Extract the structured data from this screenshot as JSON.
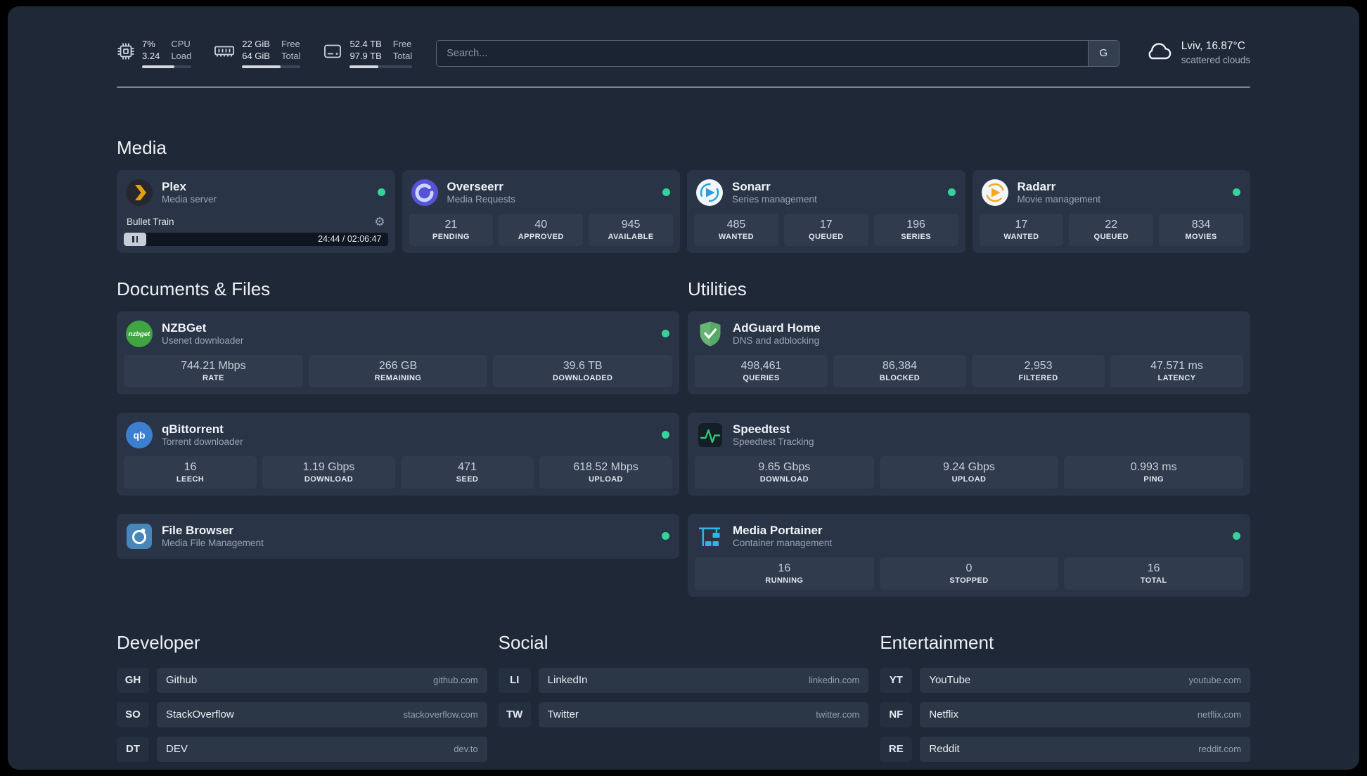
{
  "topbar": {
    "cpu": {
      "value_top": "7%",
      "value_bottom": "3.24",
      "label_top": "CPU",
      "label_bottom": "Load",
      "bar_percent": 65
    },
    "memory": {
      "value_top": "22 GiB",
      "value_bottom": "64 GiB",
      "label_top": "Free",
      "label_bottom": "Total",
      "bar_percent": 66
    },
    "disk": {
      "value_top": "52.4 TB",
      "value_bottom": "97.9 TB",
      "label_top": "Free",
      "label_bottom": "Total",
      "bar_percent": 46
    },
    "search": {
      "placeholder": "Search...",
      "button_label": "G"
    },
    "weather": {
      "location": "Lviv, 16.87°C",
      "condition": "scattered clouds"
    }
  },
  "colors": {
    "status_online": "#34d399",
    "background": "#1e2836",
    "card": "#293447"
  },
  "media": {
    "title": "Media",
    "plex": {
      "name": "Plex",
      "subtitle": "Media server",
      "player": {
        "track": "Bullet Train",
        "time": "24:44 / 02:06:47"
      }
    },
    "overseerr": {
      "name": "Overseerr",
      "subtitle": "Media Requests",
      "stats": [
        {
          "value": "21",
          "label": "PENDING"
        },
        {
          "value": "40",
          "label": "APPROVED"
        },
        {
          "value": "945",
          "label": "AVAILABLE"
        }
      ]
    },
    "sonarr": {
      "name": "Sonarr",
      "subtitle": "Series management",
      "stats": [
        {
          "value": "485",
          "label": "WANTED"
        },
        {
          "value": "17",
          "label": "QUEUED"
        },
        {
          "value": "196",
          "label": "SERIES"
        }
      ]
    },
    "radarr": {
      "name": "Radarr",
      "subtitle": "Movie management",
      "stats": [
        {
          "value": "17",
          "label": "WANTED"
        },
        {
          "value": "22",
          "label": "QUEUED"
        },
        {
          "value": "834",
          "label": "MOVIES"
        }
      ]
    }
  },
  "documents": {
    "title": "Documents & Files",
    "nzbget": {
      "name": "NZBGet",
      "subtitle": "Usenet downloader",
      "stats": [
        {
          "value": "744.21 Mbps",
          "label": "RATE"
        },
        {
          "value": "266 GB",
          "label": "REMAINING"
        },
        {
          "value": "39.6 TB",
          "label": "DOWNLOADED"
        }
      ]
    },
    "qbittorrent": {
      "name": "qBittorrent",
      "subtitle": "Torrent downloader",
      "stats": [
        {
          "value": "16",
          "label": "LEECH"
        },
        {
          "value": "1.19 Gbps",
          "label": "DOWNLOAD"
        },
        {
          "value": "471",
          "label": "SEED"
        },
        {
          "value": "618.52 Mbps",
          "label": "UPLOAD"
        }
      ]
    },
    "filebrowser": {
      "name": "File Browser",
      "subtitle": "Media File Management"
    }
  },
  "utilities": {
    "title": "Utilities",
    "adguard": {
      "name": "AdGuard Home",
      "subtitle": "DNS and adblocking",
      "stats": [
        {
          "value": "498,461",
          "label": "QUERIES"
        },
        {
          "value": "86,384",
          "label": "BLOCKED"
        },
        {
          "value": "2,953",
          "label": "FILTERED"
        },
        {
          "value": "47.571 ms",
          "label": "LATENCY"
        }
      ]
    },
    "speedtest": {
      "name": "Speedtest",
      "subtitle": "Speedtest Tracking",
      "stats": [
        {
          "value": "9.65 Gbps",
          "label": "DOWNLOAD"
        },
        {
          "value": "9.24 Gbps",
          "label": "UPLOAD"
        },
        {
          "value": "0.993 ms",
          "label": "PING"
        }
      ]
    },
    "portainer": {
      "name": "Media Portainer",
      "subtitle": "Container management",
      "stats": [
        {
          "value": "16",
          "label": "RUNNING"
        },
        {
          "value": "0",
          "label": "STOPPED"
        },
        {
          "value": "16",
          "label": "TOTAL"
        }
      ]
    }
  },
  "bookmarks": {
    "developer": {
      "title": "Developer",
      "items": [
        {
          "abbr": "GH",
          "name": "Github",
          "domain": "github.com"
        },
        {
          "abbr": "SO",
          "name": "StackOverflow",
          "domain": "stackoverflow.com"
        },
        {
          "abbr": "DT",
          "name": "DEV",
          "domain": "dev.to"
        }
      ]
    },
    "social": {
      "title": "Social",
      "items": [
        {
          "abbr": "LI",
          "name": "LinkedIn",
          "domain": "linkedin.com"
        },
        {
          "abbr": "TW",
          "name": "Twitter",
          "domain": "twitter.com"
        }
      ]
    },
    "entertainment": {
      "title": "Entertainment",
      "items": [
        {
          "abbr": "YT",
          "name": "YouTube",
          "domain": "youtube.com"
        },
        {
          "abbr": "NF",
          "name": "Netflix",
          "domain": "netflix.com"
        },
        {
          "abbr": "RE",
          "name": "Reddit",
          "domain": "reddit.com"
        }
      ]
    }
  }
}
